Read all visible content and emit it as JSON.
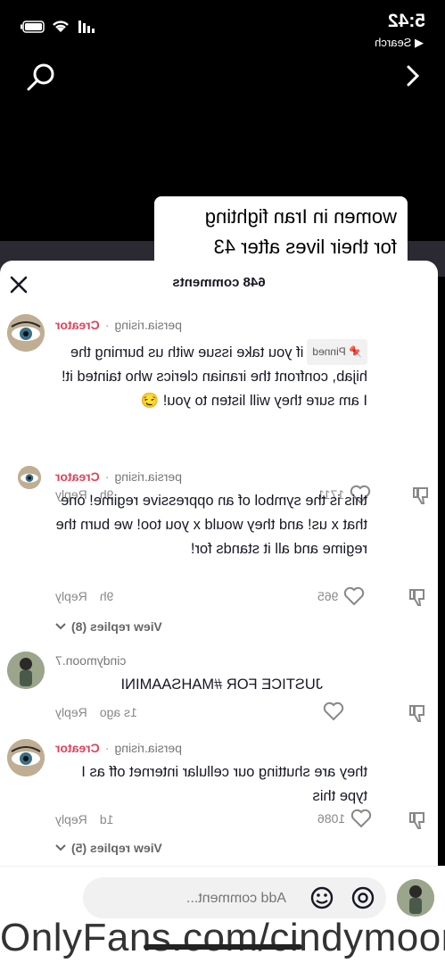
{
  "status": {
    "time": "5:42",
    "back_app": "◀ Search"
  },
  "video": {
    "caption_line1": "women in Iran fighting",
    "caption_line2": "for their lives after 43"
  },
  "sheet": {
    "title": "648 comments"
  },
  "comments": [
    {
      "user": "persia.rising",
      "badge": "Creator",
      "pinned": "📌 Pinned",
      "text": "if you take issue with us burning the hijab, confront the iranian clerics who tainted it! I am sure they will listen to you! 😏",
      "time": "9h",
      "reply": "Reply",
      "likes": "1711"
    },
    {
      "user": "persia.rising",
      "badge": "Creator",
      "text": "this is the symbol of an oppressive regime! one that x us! and they would x you too! we burn the regime and all it stands for!",
      "time": "9h",
      "reply": "Reply",
      "likes": "965",
      "view_replies": "View replies (8)"
    },
    {
      "user": "cindymoon.7",
      "text": "JUSTICE FOR #MAHSAAMINI",
      "time": "1s ago",
      "reply": "Reply",
      "likes": ""
    },
    {
      "user": "persia.rising",
      "badge": "Creator",
      "text": "they are shutting our cellular internet off as I type this",
      "time": "1d",
      "reply": "Reply",
      "likes": "1086",
      "view_replies": "View replies (5)"
    }
  ],
  "input": {
    "placeholder": "Add comment..."
  },
  "watermark": "OnlyFans.com/cindymoon",
  "colors": {
    "creator": "#e0435b",
    "sheet_bg": "#ffffff",
    "video_bg": "#000000"
  }
}
